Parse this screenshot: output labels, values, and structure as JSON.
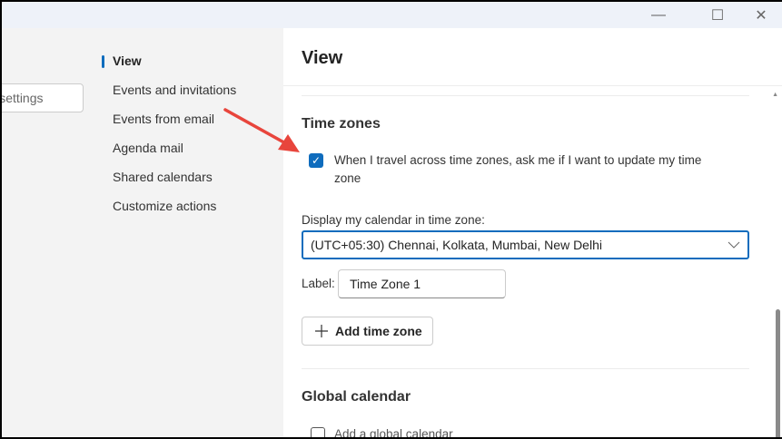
{
  "window": {
    "minimize": "—",
    "maximize": "☐",
    "close": "✕"
  },
  "search": {
    "placeholder": "Search settings",
    "visible_text": "ttings"
  },
  "nav": {
    "items": [
      "View",
      "Events and invitations",
      "Events from email",
      "Agenda mail",
      "Shared calendars",
      "Customize actions"
    ],
    "selected": "View"
  },
  "main": {
    "title": "View",
    "time_zones": {
      "heading": "Time zones",
      "travel_checkbox": {
        "checked": true,
        "label_line1": "When I travel across time zones, ask me if I want to update my time",
        "label_line2": "zone"
      },
      "display_label": "Display my calendar in time zone:",
      "selected_zone": "(UTC+05:30) Chennai, Kolkata, Mumbai, New Delhi",
      "label_caption": "Label:",
      "label_value": "Time Zone 1",
      "add_button": "Add time zone"
    },
    "global_calendar": {
      "heading": "Global calendar",
      "checkbox_label": "Add a global calendar",
      "checked": false
    }
  },
  "colors": {
    "accent": "#0f6cbd",
    "arrow": "#e8453c"
  }
}
